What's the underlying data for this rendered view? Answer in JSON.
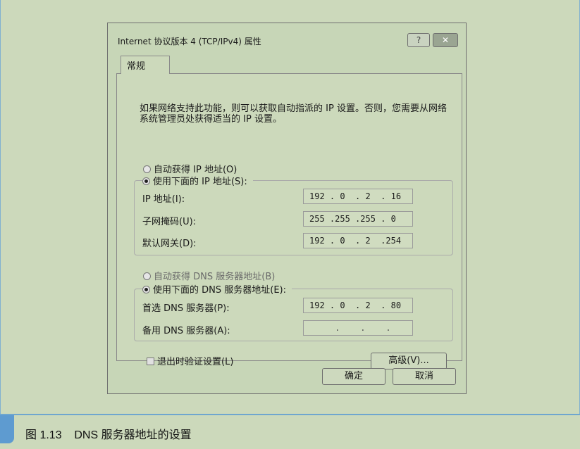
{
  "dialog": {
    "title": "Internet 协议版本 4 (TCP/IPv4) 属性",
    "help_label": "?",
    "close_label": "✕"
  },
  "tab": {
    "label": "常规"
  },
  "description": "如果网络支持此功能，则可以获取自动指派的 IP 设置。否则，您需要从网络系统管理员处获得适当的 IP 设置。",
  "ip": {
    "auto_label": "自动获得 IP 地址(O)",
    "manual_label": "使用下面的 IP 地址(S):",
    "fields": [
      {
        "label": "IP 地址(I):",
        "value": "192 . 0  . 2  . 16"
      },
      {
        "label": "子网掩码(U):",
        "value": "255 .255 .255 . 0"
      },
      {
        "label": "默认网关(D):",
        "value": "192 . 0  . 2  .254"
      }
    ]
  },
  "dns": {
    "auto_label": "自动获得 DNS 服务器地址(B)",
    "manual_label": "使用下面的 DNS 服务器地址(E):",
    "fields": [
      {
        "label": "首选 DNS 服务器(P):",
        "value": "192 . 0  . 2  . 80"
      },
      {
        "label": "备用 DNS 服务器(A):",
        "value": "     .    .    ."
      }
    ]
  },
  "validate_label": "退出时验证设置(L)",
  "advanced_label": "高级(V)...",
  "ok_label": "确定",
  "cancel_label": "取消",
  "caption": "图 1.13    DNS 服务器地址的设置",
  "colors": {
    "background": "#ccd9bb",
    "accent": "#5e9bd0"
  }
}
